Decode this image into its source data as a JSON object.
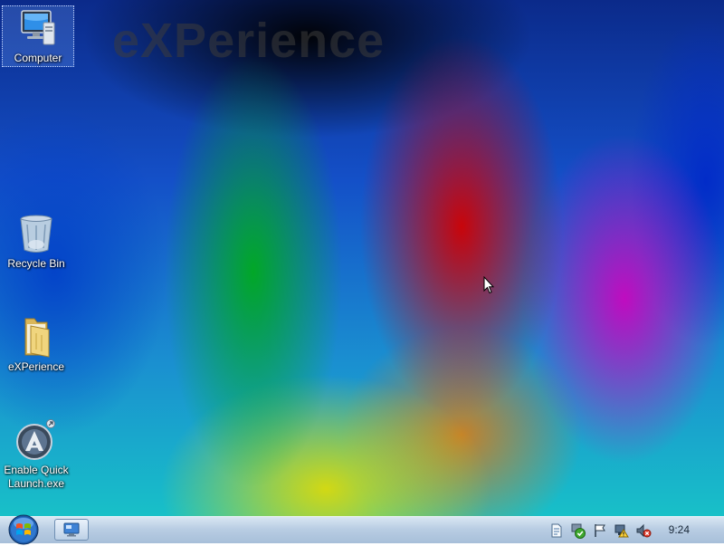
{
  "desktop": {
    "watermark": "eXPerience",
    "icons": [
      {
        "label": "Computer",
        "icon": "computer-icon",
        "selected": true
      },
      {
        "label": "Recycle Bin",
        "icon": "recycle-bin-icon"
      },
      {
        "label": "eXPerience",
        "icon": "folder-icon"
      },
      {
        "label": "Enable Quick Launch.exe",
        "icon": "quick-launch-icon"
      }
    ]
  },
  "taskbar": {
    "start_icon": "windows-orb-icon",
    "tasks": [
      {
        "icon": "show-desktop-icon"
      }
    ],
    "tray": [
      {
        "icon": "document-icon"
      },
      {
        "icon": "security-check-icon"
      },
      {
        "icon": "action-center-flag-icon"
      },
      {
        "icon": "network-warning-icon"
      },
      {
        "icon": "volume-muted-icon"
      }
    ],
    "clock": "9:24"
  },
  "colors": {
    "taskbar": "#b9cde3",
    "text": "#ffffff"
  }
}
